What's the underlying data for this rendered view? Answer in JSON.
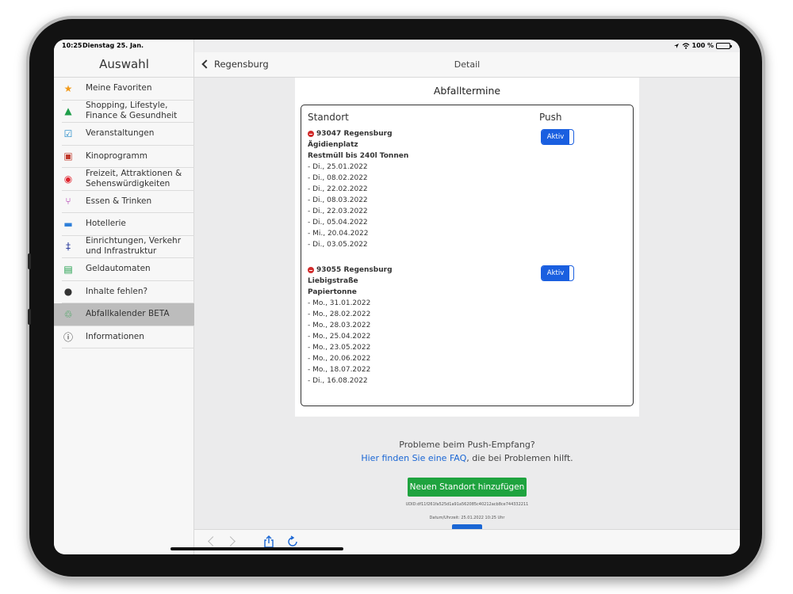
{
  "status": {
    "time": "10:25",
    "date": "Dienstag 25. Jan.",
    "battery": "100 %"
  },
  "sidebar": {
    "title": "Auswahl",
    "items": [
      {
        "label": "Meine Favoriten",
        "icon": "star-icon",
        "color": "#f29a1a"
      },
      {
        "label": "Shopping, Lifestyle,\nFinance & Gesundheit",
        "icon": "shopping-bag-icon",
        "color": "#1f9e4a"
      },
      {
        "label": "Veranstaltungen",
        "icon": "calendar-check-icon",
        "color": "#1e88c8"
      },
      {
        "label": "Kinoprogramm",
        "icon": "film-clapper-icon",
        "color": "#c0392b"
      },
      {
        "label": "Freizeit, Attraktionen &\nSehenswürdigkeiten",
        "icon": "eye-icon",
        "color": "#e0242e"
      },
      {
        "label": "Essen & Trinken",
        "icon": "utensils-icon",
        "color": "#a51fa5"
      },
      {
        "label": "Hotellerie",
        "icon": "bed-icon",
        "color": "#2e7fd9"
      },
      {
        "label": "Einrichtungen, Verkehr\nund Infrastruktur",
        "icon": "signpost-icon",
        "color": "#2c3e9e"
      },
      {
        "label": "Geldautomaten",
        "icon": "atm-icon",
        "color": "#1f9e4a"
      },
      {
        "label": "Inhalte fehlen?",
        "icon": "chat-bubbles-icon",
        "color": "#333333"
      },
      {
        "label": "Abfallkalender BETA",
        "icon": "recycle-icon",
        "color": "#2aa14a",
        "active": true
      },
      {
        "label": "Informationen",
        "icon": "info-icon",
        "color": "#222222"
      }
    ]
  },
  "navbar": {
    "back_label": "Regensburg",
    "title": "Detail"
  },
  "card": {
    "title": "Abfalltermine",
    "col_standort": "Standort",
    "col_push": "Push",
    "entries": [
      {
        "location": "93047 Regensburg",
        "street": "Ägidienplatz",
        "type": "Restmüll bis 240l Tonnen",
        "dates": [
          "- Di., 25.01.2022",
          "- Di., 08.02.2022",
          "- Di., 22.02.2022",
          "- Di., 08.03.2022",
          "- Di., 22.03.2022",
          "- Di., 05.04.2022",
          "- Mi., 20.04.2022",
          "- Di., 03.05.2022"
        ],
        "push_label": "Aktiv"
      },
      {
        "location": "93055 Regensburg",
        "street": "Liebigstraße",
        "type": "Papiertonne",
        "dates": [
          "- Mo., 31.01.2022",
          "- Mo., 28.02.2022",
          "- Mo., 28.03.2022",
          "- Mo., 25.04.2022",
          "- Mo., 23.05.2022",
          "- Mo., 20.06.2022",
          "- Mo., 18.07.2022",
          "- Di., 16.08.2022"
        ],
        "push_label": "Aktiv"
      }
    ]
  },
  "help": {
    "line1": "Probleme beim Push-Empfang?",
    "link": "Hier finden Sie eine FAQ",
    "line2_suffix": ", die bei Problemen hilft."
  },
  "add_button_label": "Neuen Standort hinzufügen",
  "udid": "UDID:df11f261fa525d1a91a562085c40212acb8ce744332211",
  "datetime": "Datum/Uhrzeit: 25.01.2022 10:25 Uhr",
  "colors": {
    "accent_blue": "#1a5fe0",
    "button_green": "#1fa33f",
    "link_blue": "#1a66d4",
    "remove_red": "#d12b2b"
  }
}
